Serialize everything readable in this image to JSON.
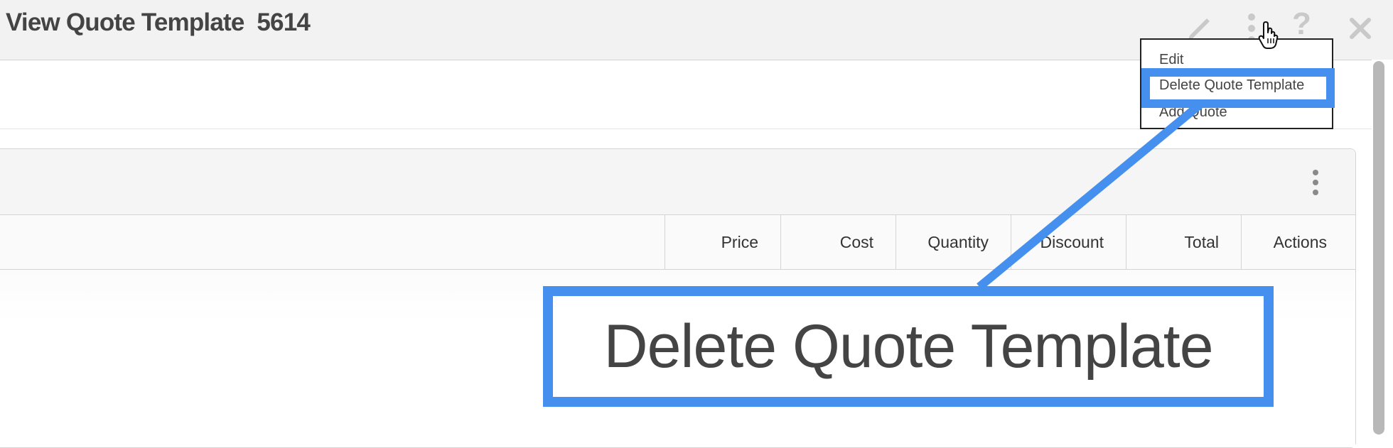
{
  "header": {
    "title": "View Quote Template  5614",
    "icons": [
      "pencil-icon",
      "more-vertical-icon",
      "help-icon",
      "close-icon"
    ]
  },
  "menu": {
    "items": [
      "Edit",
      "Delete Quote Template",
      "Add Quote"
    ],
    "highlighted": "Delete Quote Template"
  },
  "table": {
    "columns": [
      "Price",
      "Cost",
      "Quantity",
      "Discount",
      "Total",
      "Actions"
    ]
  },
  "callout": {
    "text": "Delete Quote Template",
    "color": "#4590ef"
  }
}
